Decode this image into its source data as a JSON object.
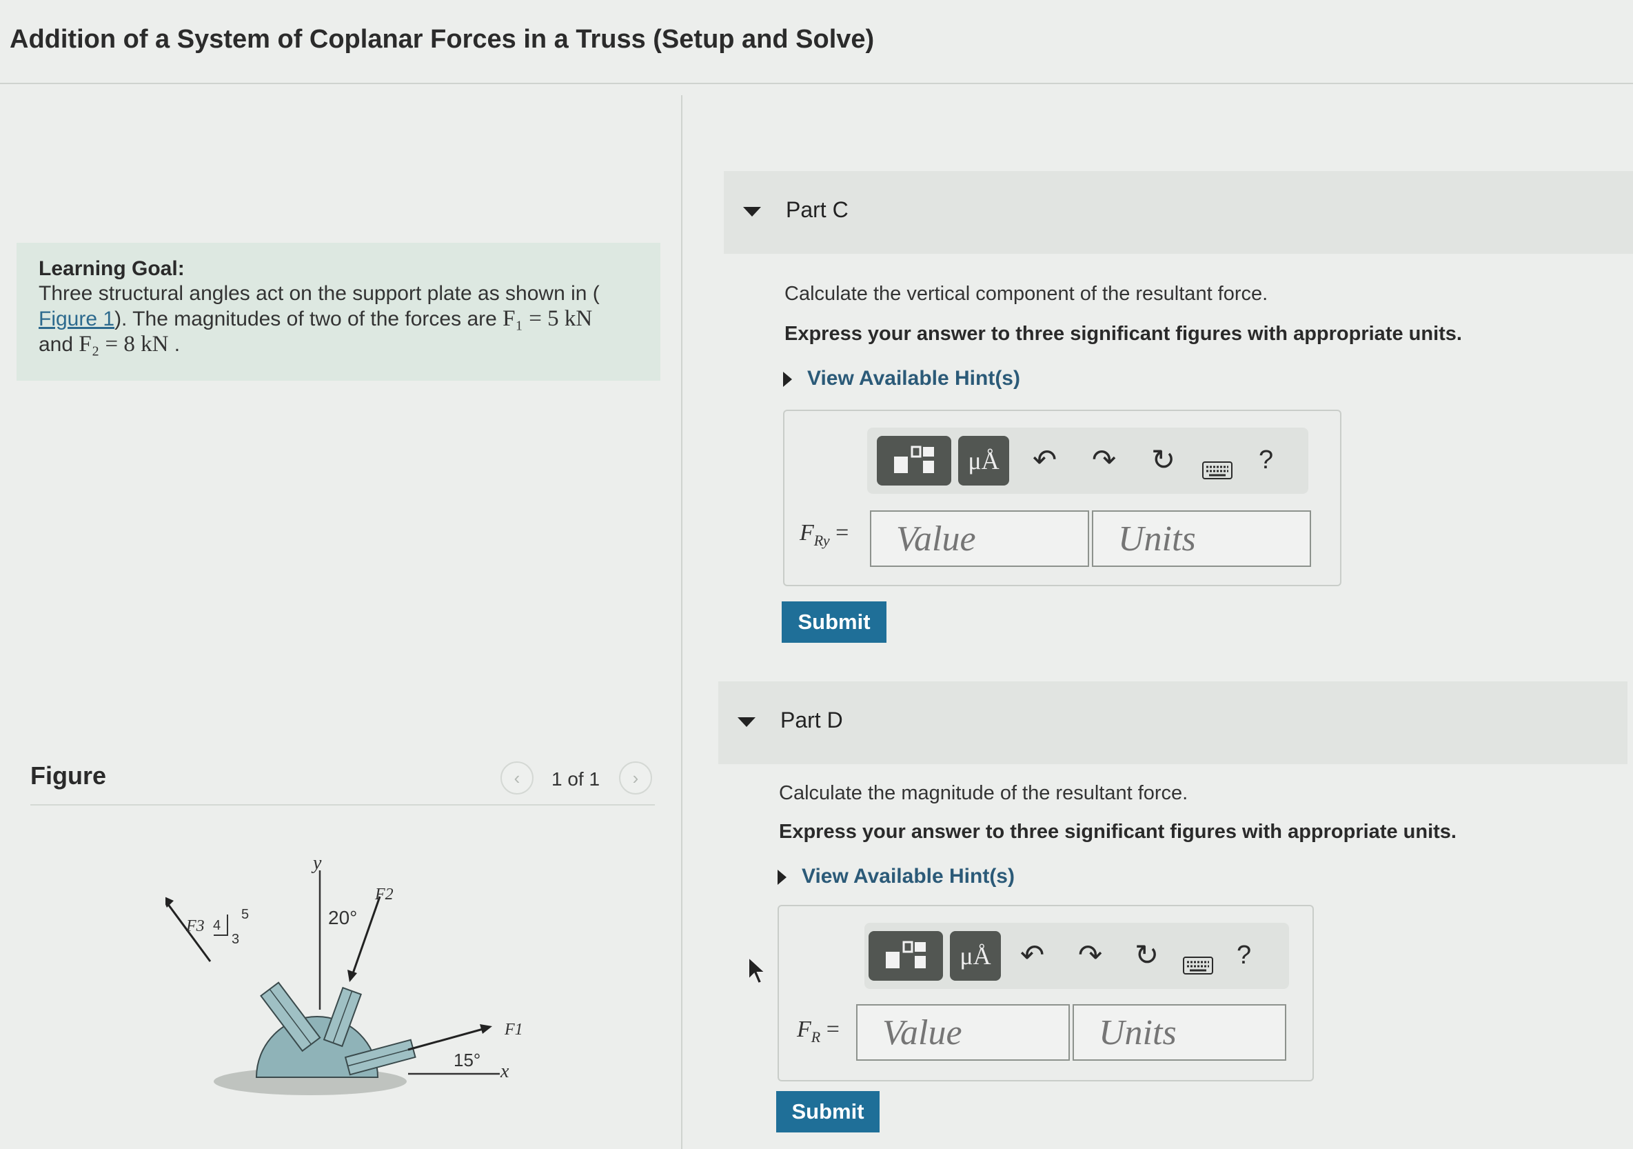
{
  "page": {
    "title": "Addition of a System of Coplanar Forces in a Truss (Setup and Solve)"
  },
  "learning_goal": {
    "heading": "Learning Goal:",
    "text_before": "Three structural angles act on the support plate as shown in (",
    "figure_link": "Figure 1",
    "text_after": "). The magnitudes of two of the forces are ",
    "f1": "F₁ = 5 kN",
    "joiner": "and ",
    "f2": "F₂ = 8 kN",
    "end": " ."
  },
  "figure": {
    "label": "Figure",
    "pager_text": "1 of 1",
    "prev_icon": "chevron-left-icon",
    "next_icon": "chevron-right-icon",
    "labels": {
      "y": "y",
      "x": "x",
      "f1": "F1",
      "f2": "F2",
      "f3": "F3",
      "angle_20": "20°",
      "angle_15": "15°",
      "tri_4": "4",
      "tri_3": "3",
      "tri_5": "5"
    }
  },
  "parts": [
    {
      "label": "Part C",
      "question": "Calculate the vertical component of the resultant force.",
      "instruction": "Express your answer to three significant figures with appropriate units.",
      "hint": "View Available Hint(s)",
      "variable": "F",
      "subscript": "Ry",
      "equals": " =",
      "value_placeholder": "Value",
      "units_placeholder": "Units",
      "submit": "Submit"
    },
    {
      "label": "Part D",
      "question": "Calculate the magnitude of the resultant force.",
      "instruction": "Express your answer to three significant figures with appropriate units.",
      "hint": "View Available Hint(s)",
      "variable": "F",
      "subscript": "R",
      "equals": " =",
      "value_placeholder": "Value",
      "units_placeholder": "Units",
      "submit": "Submit"
    }
  ],
  "toolbar": {
    "units_button": "μÅ",
    "help": "?",
    "icons": [
      "templates-icon",
      "units-icon",
      "undo-icon",
      "redo-icon",
      "reset-icon",
      "keyboard-icon",
      "help-icon"
    ]
  },
  "colors": {
    "accent": "#1f6f98",
    "link": "#2b5a78",
    "goal_bg": "#dde8e1",
    "plate": "#8fb3b8"
  }
}
